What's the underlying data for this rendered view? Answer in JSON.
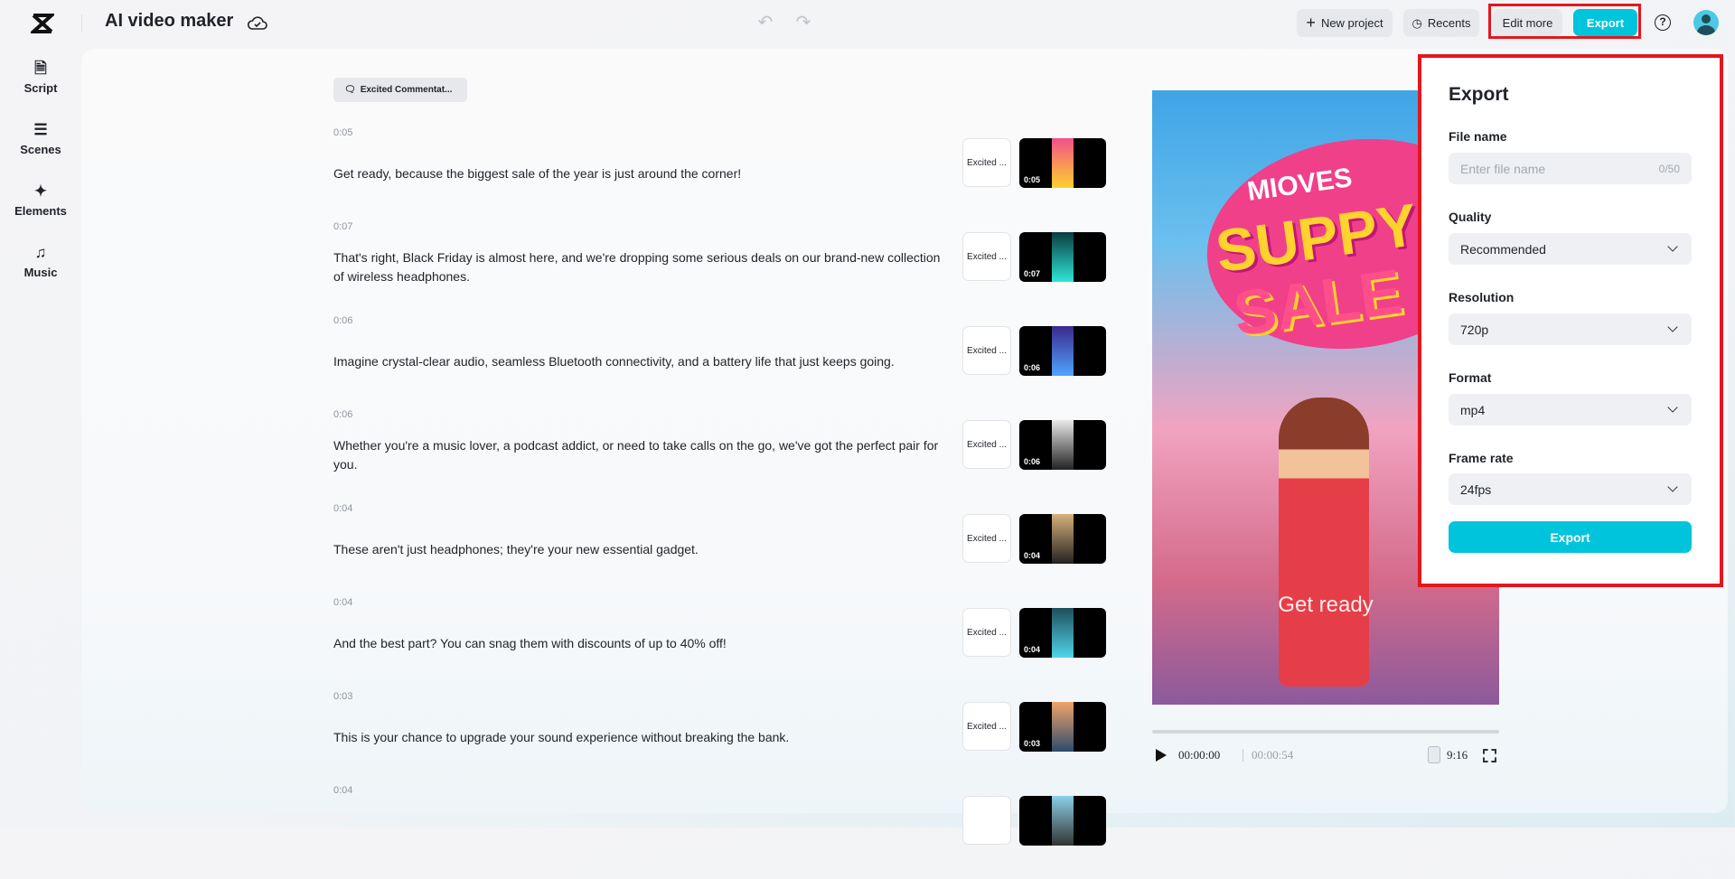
{
  "header": {
    "title": "AI video maker",
    "new_project": "New project",
    "recents": "Recents",
    "edit_more": "Edit more",
    "export": "Export",
    "help": "?"
  },
  "sidebar": {
    "items": [
      {
        "label": "Script",
        "icon": "script-icon"
      },
      {
        "label": "Scenes",
        "icon": "scenes-icon"
      },
      {
        "label": "Elements",
        "icon": "elements-icon"
      },
      {
        "label": "Music",
        "icon": "music-icon"
      }
    ]
  },
  "script": {
    "voice": "Excited Commentat...",
    "rows": [
      {
        "time": "0:05",
        "text": "Get ready, because the biggest sale of the year is just around the corner!",
        "voice": "Excited ...",
        "duration": "0:05"
      },
      {
        "time": "0:07",
        "text": "That's right, Black Friday is almost here, and we're dropping some serious deals on our brand-new collection of wireless headphones.",
        "voice": "Excited ...",
        "duration": "0:07"
      },
      {
        "time": "0:06",
        "text": "Imagine crystal-clear audio, seamless Bluetooth connectivity, and a battery life that just keeps going.",
        "voice": "Excited ...",
        "duration": "0:06"
      },
      {
        "time": "0:06",
        "text": "Whether you're a music lover, a podcast addict, or need to take calls on the go, we've got the perfect pair for you.",
        "voice": "Excited ...",
        "duration": "0:06"
      },
      {
        "time": "0:04",
        "text": "These aren't just headphones; they're your new essential gadget.",
        "voice": "Excited ...",
        "duration": "0:04"
      },
      {
        "time": "0:04",
        "text": "And the best part? You can snag them with discounts of up to 40% off!",
        "voice": "Excited ...",
        "duration": "0:04"
      },
      {
        "time": "0:03",
        "text": "This is your chance to upgrade your sound experience without breaking the bank.",
        "voice": "Excited ...",
        "duration": "0:03"
      },
      {
        "time": "0:04",
        "text": "",
        "voice": "",
        "duration": ""
      }
    ]
  },
  "preview": {
    "art_text": [
      "MIOVES",
      "SUPPY",
      "SALE"
    ],
    "caption": "Get ready",
    "current_time": "00:00:00",
    "total_time": "00:00:54",
    "aspect_ratio": "9:16",
    "progress": 0
  },
  "export_panel": {
    "title": "Export",
    "file_name_label": "File name",
    "file_name_placeholder": "Enter file name",
    "file_name_count": "0/50",
    "quality_label": "Quality",
    "quality": "Recommended",
    "resolution_label": "Resolution",
    "resolution": "720p",
    "format_label": "Format",
    "format": "mp4",
    "frame_rate_label": "Frame rate",
    "frame_rate": "24fps",
    "export_button": "Export"
  },
  "colors": {
    "accent": "#00c4dc",
    "highlight": "#e5161d"
  }
}
